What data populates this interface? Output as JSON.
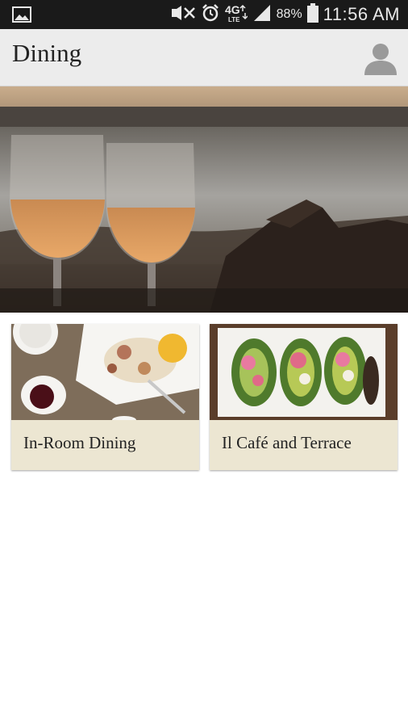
{
  "status_bar": {
    "battery": "88%",
    "time": "11:56 AM",
    "network": "4G LTE",
    "icons": [
      "image-notification-icon",
      "mute-icon",
      "alarm-icon",
      "4g-lte-icon",
      "signal-icon",
      "battery-icon"
    ]
  },
  "app_bar": {
    "title": "Dining",
    "icons": [
      "profile-icon"
    ]
  },
  "hero": {
    "subject": "wine-glasses-on-beach"
  },
  "cards": [
    {
      "label": "In-Room Dining"
    },
    {
      "label": "Il Café and Terrace"
    }
  ],
  "colors": {
    "status_bar": "#1a1a1a",
    "app_bar": "#ececec",
    "card_footer": "#ece6d2"
  }
}
